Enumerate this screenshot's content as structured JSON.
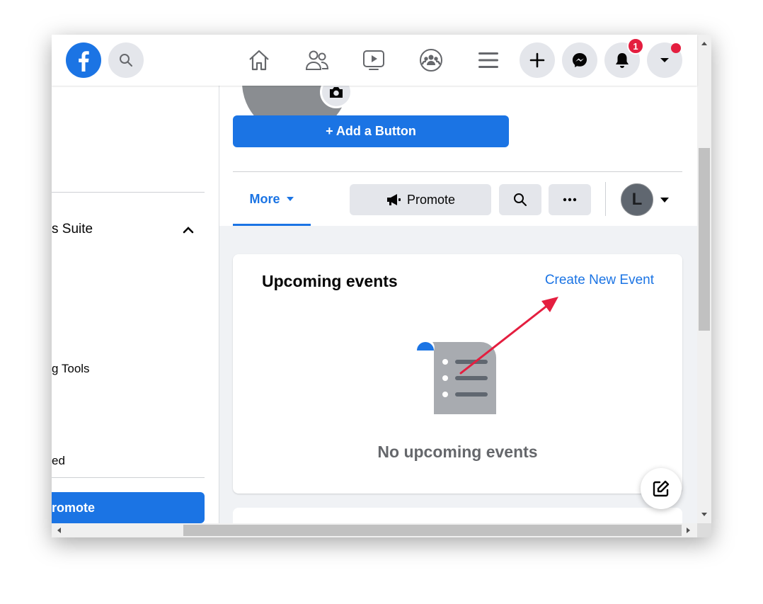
{
  "topbar": {
    "notifications_count": "1"
  },
  "sidebar": {
    "items": [
      {
        "label": "s Suite"
      },
      {
        "label": "g Tools"
      },
      {
        "label": "ed"
      }
    ],
    "promote_label": "romote"
  },
  "page_header": {
    "add_button_label": "+ Add a Button",
    "tabs": {
      "more_label": "More"
    },
    "promote_button_label": "Promote",
    "avatar_initial": "L"
  },
  "events_card": {
    "title": "Upcoming events",
    "create_link": "Create New Event",
    "empty_text": "No upcoming events"
  },
  "colors": {
    "brand_blue": "#1b74e4",
    "annotation_red": "#e41e3f",
    "badge_red": "#e41e3f"
  }
}
